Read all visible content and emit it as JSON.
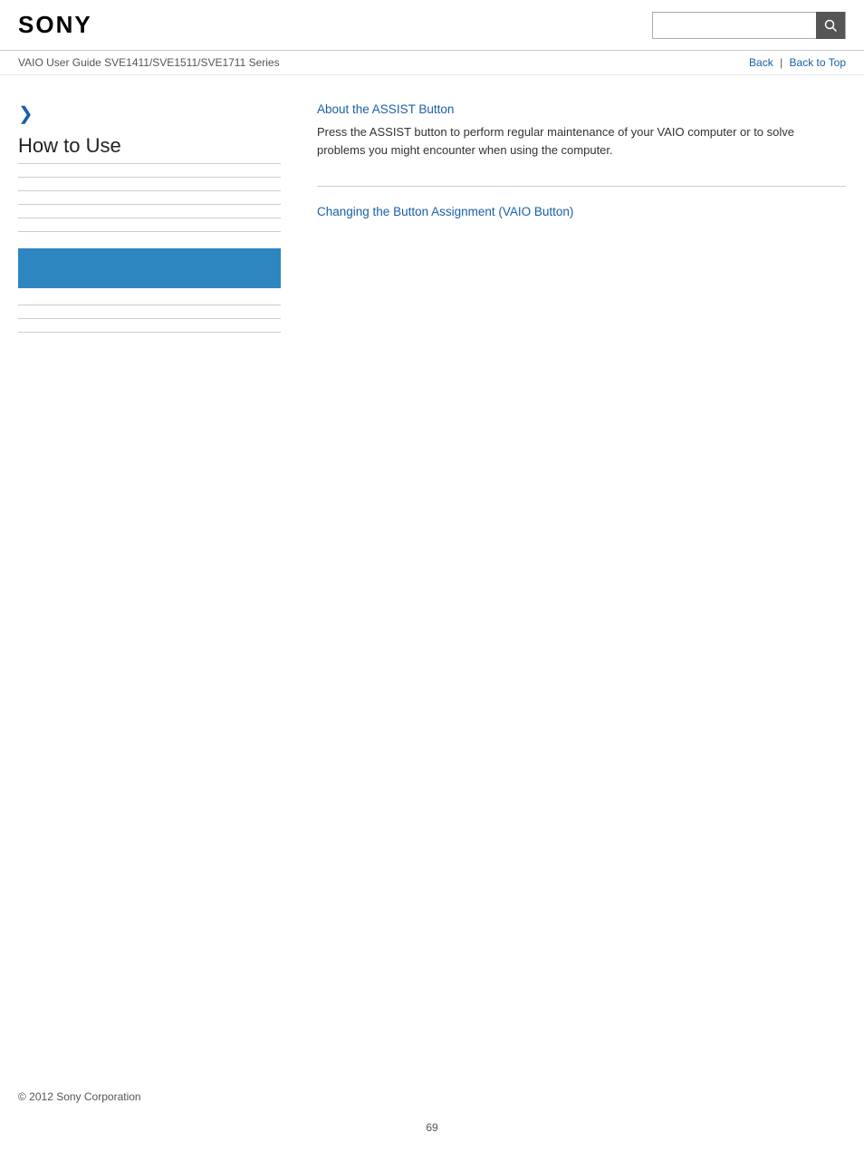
{
  "header": {
    "logo": "SONY",
    "search_placeholder": ""
  },
  "subheader": {
    "guide_title": "VAIO User Guide SVE1411/SVE1511/SVE1711 Series",
    "back_label": "Back",
    "back_to_top_label": "Back to Top"
  },
  "sidebar": {
    "chevron": "❯",
    "section_title": "How to Use",
    "items": [
      {
        "id": "divider1"
      },
      {
        "id": "divider2"
      },
      {
        "id": "divider3"
      },
      {
        "id": "divider4"
      },
      {
        "id": "divider5"
      },
      {
        "id": "highlight"
      },
      {
        "id": "divider6"
      },
      {
        "id": "divider7"
      },
      {
        "id": "divider8"
      }
    ]
  },
  "main": {
    "articles": [
      {
        "id": "assist-button",
        "link_text": "About the ASSIST Button",
        "description": "Press the ASSIST button to perform regular maintenance of your VAIO computer or to solve problems you might encounter when using the computer."
      },
      {
        "id": "button-assignment",
        "link_text": "Changing the Button Assignment (VAIO Button)",
        "description": ""
      }
    ]
  },
  "footer": {
    "copyright": "© 2012 Sony Corporation"
  },
  "page_number": "69"
}
